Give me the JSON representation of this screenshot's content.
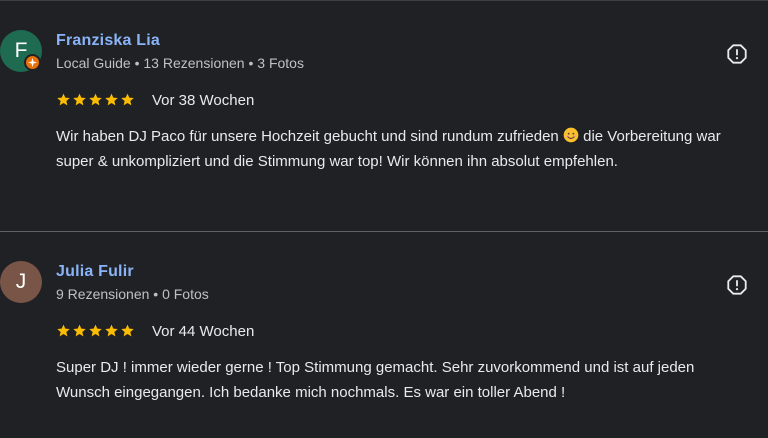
{
  "reviews": [
    {
      "initial": "F",
      "name": "Franziska Lia",
      "meta": "Local Guide • 13 Rezensionen • 3 Fotos",
      "rating": 5,
      "time": "Vor 38 Wochen",
      "text_before_emoji": "Wir haben DJ Paco für unsere Hochzeit gebucht und sind rundum zufrieden ",
      "emoji_icon": "smiling-face-emoji",
      "text_after_emoji": " die Vorbereitung war super & unkompliziert und die Stimmung war top! Wir können ihn absolut empfehlen.",
      "avatar_color": "#1e6b52",
      "local_guide_badge": true
    },
    {
      "initial": "J",
      "name": "Julia Fulir",
      "meta": "9 Rezensionen • 0 Fotos",
      "rating": 5,
      "time": "Vor 44 Wochen",
      "text": "Super DJ ! immer wieder gerne ! Top Stimmung gemacht. Sehr zuvorkommend und ist auf jeden Wunsch eingegangen. Ich bedanke mich nochmals. Es war ein toller Abend !",
      "avatar_color": "#795548",
      "local_guide_badge": false
    }
  ],
  "colors": {
    "background": "#202124",
    "name": "#8ab4f8",
    "star": "#fbbc04",
    "text": "#e8eaed",
    "meta": "#bdc1c6"
  },
  "icons": {
    "report": "report-octagon-icon",
    "star": "star-icon",
    "badge": "local-guide-badge-icon"
  }
}
